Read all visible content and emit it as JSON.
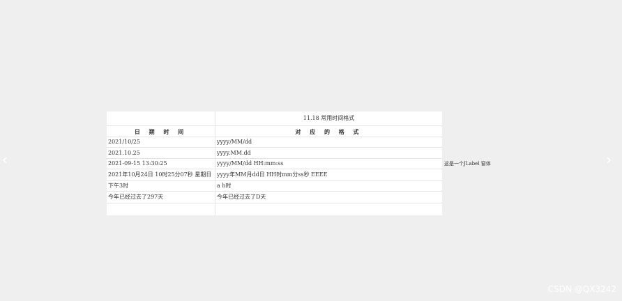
{
  "nav": {
    "prev_glyph": "‹",
    "next_glyph": "›"
  },
  "table": {
    "caption": "11.18 常用时间格式",
    "headers": [
      "日 期 时 间",
      "对 应 的 格 式"
    ],
    "rows": [
      [
        "2021/10/25",
        "yyyy/MM/dd"
      ],
      [
        "2021.10.25",
        "yyyy.MM.dd"
      ],
      [
        "2021-09-15   13:30:25",
        "yyyy/MM/dd   HH:mm:ss"
      ],
      [
        "2021年10月24日 10时25分07秒 星期日",
        "yyyy年MM月dd日  HH时mm分ss秒  EEEE"
      ],
      [
        "下午3时",
        "a h时"
      ],
      [
        "今年已经过去了297天",
        "今年已经过去了D天"
      ],
      [
        "",
        ""
      ]
    ]
  },
  "side_label": "这是一个JLabel 窗体",
  "watermark": "CSDN @QX3242"
}
